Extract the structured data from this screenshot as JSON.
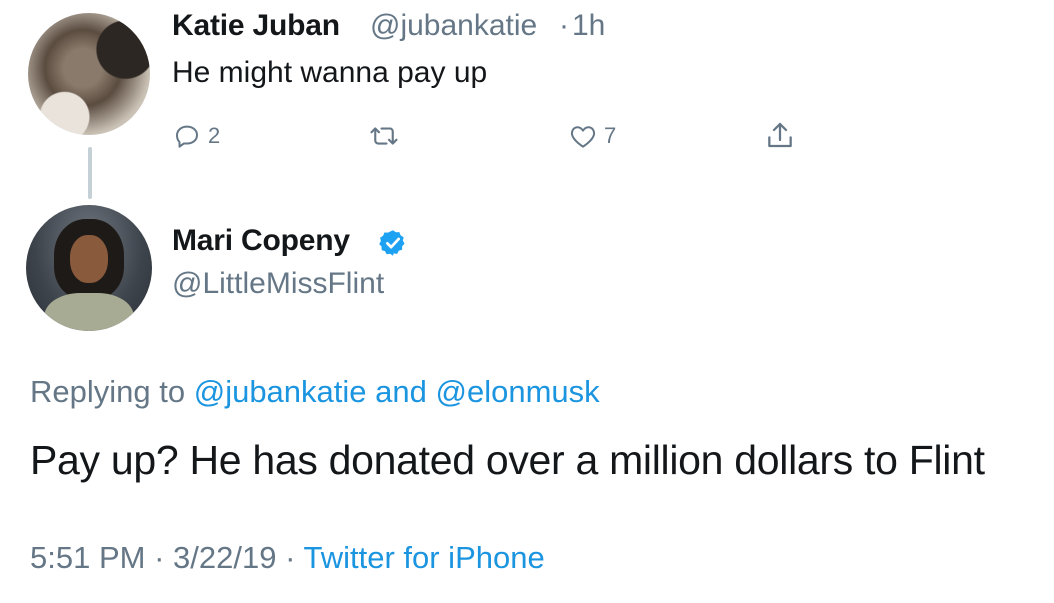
{
  "parent_tweet": {
    "author_name": "Katie Juban",
    "handle": "@jubankatie",
    "separator": "·",
    "time": "1h",
    "text": "He might wanna pay up",
    "actions": {
      "reply_count": "2",
      "retweet_count": "",
      "like_count": "7"
    }
  },
  "reply_tweet": {
    "author_name": "Mari Copeny",
    "handle": "@LittleMissFlint",
    "verified": true,
    "replying_prefix": "Replying to",
    "replying_mention_1": "@jubankatie",
    "replying_and": "and",
    "replying_mention_2": "@elonmusk",
    "text": "Pay up? He has donated over a million dollars to Flint",
    "time": "5:51 PM",
    "date": "3/22/19",
    "separator": "·",
    "source": "Twitter for iPhone"
  },
  "colors": {
    "text": "#14171a",
    "muted": "#657786",
    "link": "#1b95e0",
    "verified": "#1da1f2",
    "thread_line": "#c4cfd6"
  },
  "icons": [
    "reply-icon",
    "retweet-icon",
    "like-icon",
    "share-icon",
    "verified-badge-icon"
  ]
}
